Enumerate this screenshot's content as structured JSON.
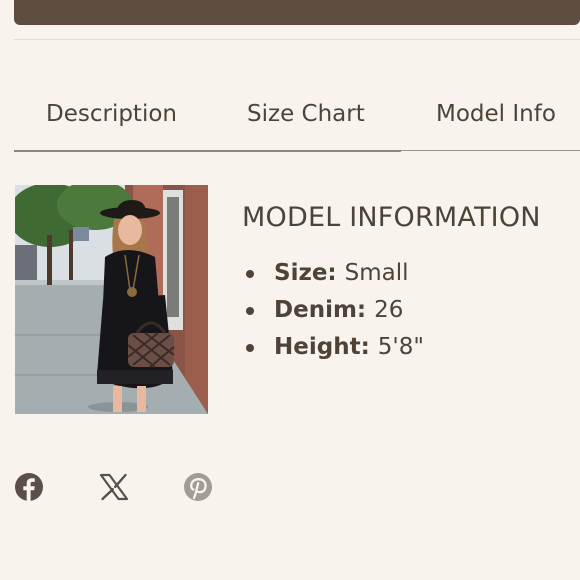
{
  "tabs": [
    {
      "label": "Description"
    },
    {
      "label": "Size Chart"
    },
    {
      "label": "Model Info",
      "active": true
    }
  ],
  "model_info": {
    "title": "MODEL INFORMATION",
    "items": [
      {
        "label": "Size:",
        "value": "Small"
      },
      {
        "label": "Denim:",
        "value": "26"
      },
      {
        "label": "Height:",
        "value": "5'8\""
      }
    ]
  },
  "social": {
    "icons": [
      "facebook-icon",
      "x-icon",
      "pinterest-icon"
    ]
  },
  "colors": {
    "background": "#f8f4ed",
    "top_bar": "#5d4c40",
    "text": "#4f4337",
    "social_icons": [
      "#5a5048",
      "#5a5048",
      "#a39c96"
    ]
  }
}
